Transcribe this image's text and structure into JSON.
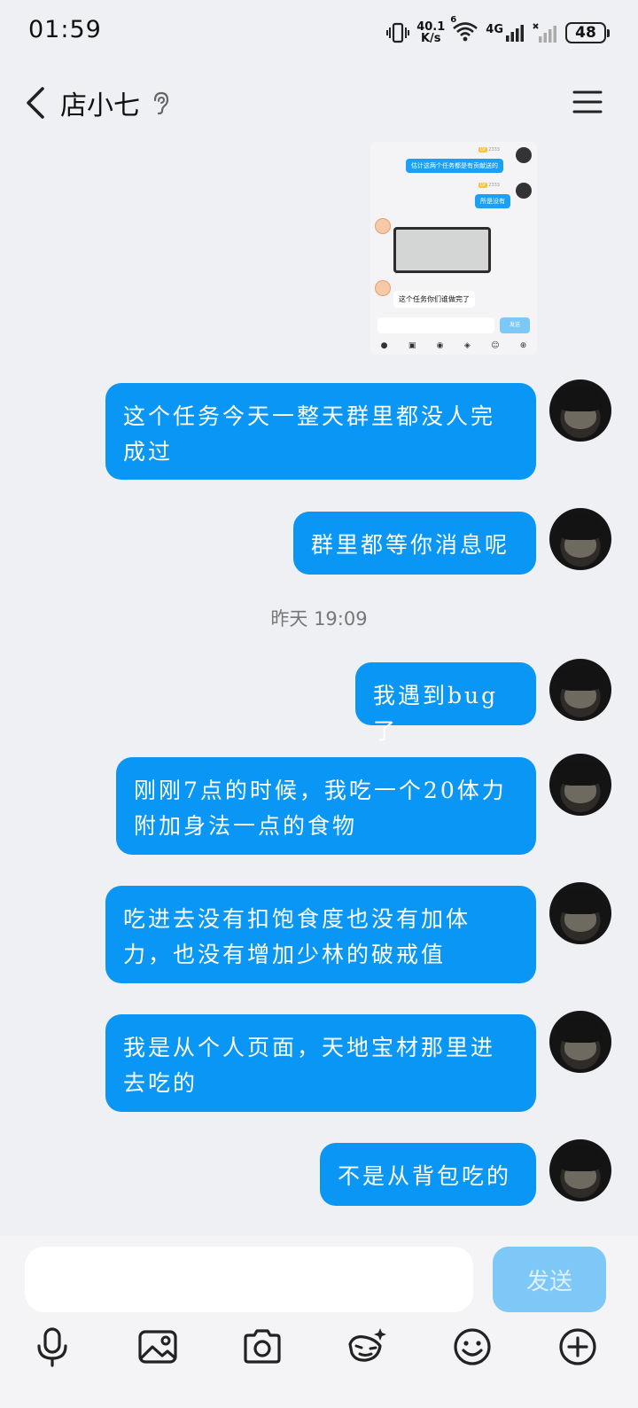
{
  "status_bar": {
    "time": "01:59",
    "net_speed_value": "40.1",
    "net_speed_unit": "K/s",
    "wifi_badge": "6",
    "cell_label": "4G",
    "battery": "48"
  },
  "header": {
    "title": "店小七"
  },
  "screenshot_preview": {
    "msg1": "估计这两个任务都是有贡献送的",
    "msg2": "所是没有",
    "caption": "这个任务你们谁做完了",
    "send": "发送",
    "tag_level": "LV",
    "tag_id": "2333"
  },
  "messages": [
    {
      "text": "这个任务今天一整天群里都没人完成过"
    },
    {
      "text": "群里都等你消息呢"
    },
    {
      "text": "我遇到bug了"
    },
    {
      "text": "刚刚7点的时候，我吃一个20体力附加身法一点的食物"
    },
    {
      "text": "吃进去没有扣饱食度也没有加体力，也没有增加少林的破戒值"
    },
    {
      "text": "我是从个人页面，天地宝材那里进去吃的"
    },
    {
      "text": "不是从背包吃的"
    }
  ],
  "timestamp": "昨天 19:09",
  "input": {
    "placeholder": "",
    "send_label": "发送"
  },
  "icons": {
    "voice": "microphone-icon",
    "image": "image-icon",
    "camera": "camera-icon",
    "sticker": "sticker-icon",
    "emoji": "emoji-icon",
    "more": "plus-icon"
  }
}
